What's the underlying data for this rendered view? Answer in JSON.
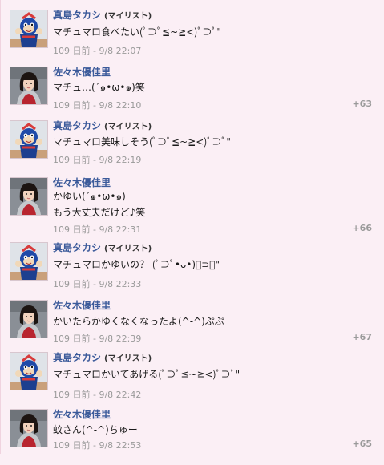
{
  "comments": [
    {
      "author": "真島タカシ",
      "badge": "(マイリスト)",
      "lines": [
        "マチュマロ食べたい(ﾟ⊃ﾟ≦~≧<)ﾟ⊃ﾟ\""
      ],
      "timestamp": "109 日前 - 9/8 22:07",
      "plus": "",
      "avatar": "mascot-avatar-icon"
    },
    {
      "author": "佐々木優佳里",
      "badge": "",
      "lines": [
        "マチュ…(´๑•ω•๑)笑"
      ],
      "timestamp": "109 日前 - 9/8 22:10",
      "plus": "+63",
      "avatar": "person-avatar-icon"
    },
    {
      "author": "真島タカシ",
      "badge": "(マイリスト)",
      "lines": [
        "マチュマロ美味しそう(ﾟ⊃ﾟ≦~≧<)ﾟ⊃ﾟ\""
      ],
      "timestamp": "109 日前 - 9/8 22:19",
      "plus": "",
      "avatar": "mascot-avatar-icon"
    },
    {
      "author": "佐々木優佳里",
      "badge": "",
      "lines": [
        "かゆい(´๑•ω•๑)",
        "もう大丈夫だけど♪笑"
      ],
      "timestamp": "109 日前 - 9/8 22:31",
      "plus": "+66",
      "avatar": "person-avatar-icon"
    },
    {
      "author": "真島タカシ",
      "badge": "(マイリスト)",
      "lines": [
        "マチュマロかゆいの？ (ﾟ⊃ﾟ•ᴗ•)ﾟ⊃ﾟ\""
      ],
      "timestamp": "109 日前 - 9/8 22:33",
      "plus": "",
      "avatar": "mascot-avatar-icon"
    },
    {
      "author": "佐々木優佳里",
      "badge": "",
      "lines": [
        "かいたらかゆくなくなったよ(^-^)ぷぷ"
      ],
      "timestamp": "109 日前 - 9/8 22:39",
      "plus": "+67",
      "avatar": "person-avatar-icon"
    },
    {
      "author": "真島タカシ",
      "badge": "(マイリスト)",
      "lines": [
        "マチュマロかいてあげる(ﾟ⊃ﾟ≦~≧<)ﾟ⊃ﾟ\""
      ],
      "timestamp": "109 日前 - 9/8 22:42",
      "plus": "",
      "avatar": "mascot-avatar-icon"
    },
    {
      "author": "佐々木優佳里",
      "badge": "",
      "lines": [
        "蚊さん(^-^)ちゅー"
      ],
      "timestamp": "109 日前 - 9/8 22:53",
      "plus": "+65",
      "avatar": "person-avatar-icon"
    }
  ]
}
